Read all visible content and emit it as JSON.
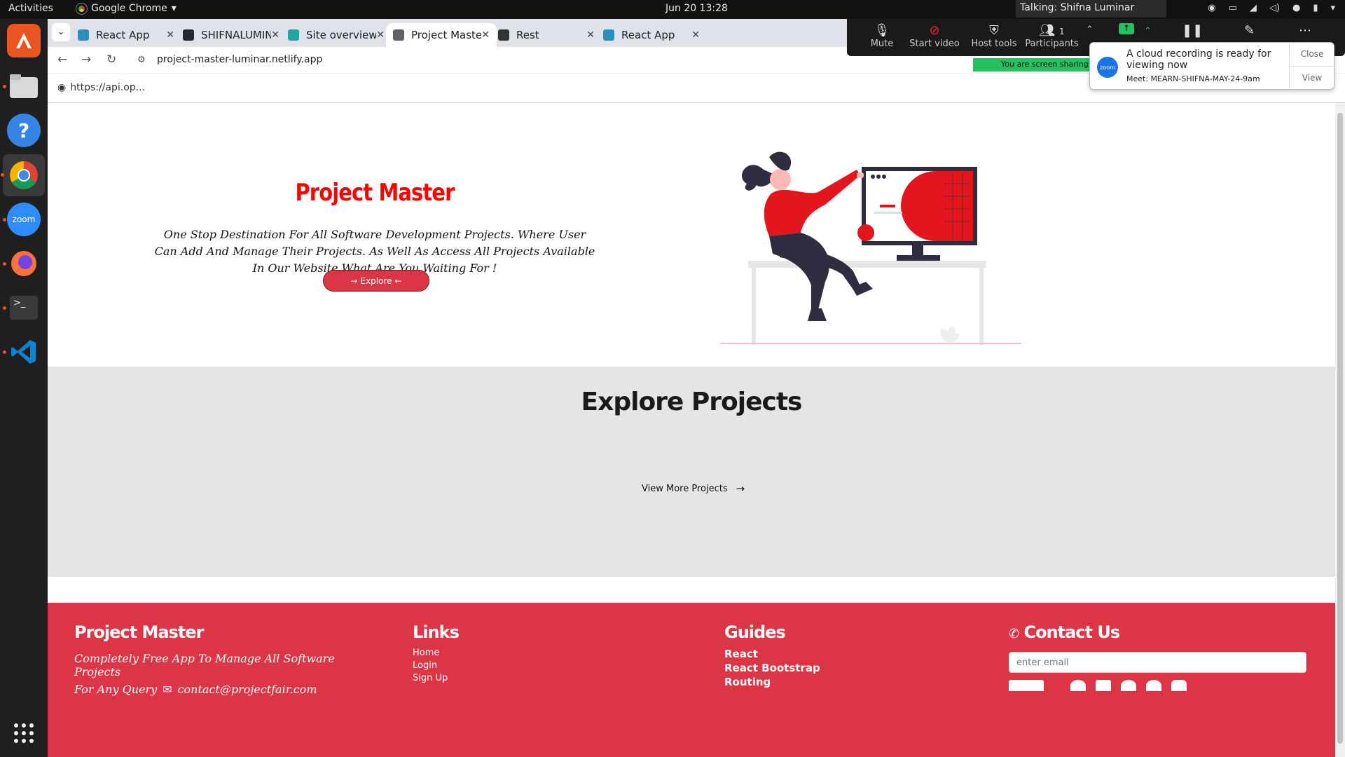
{
  "topbar": {
    "activities": "Activities",
    "app_name": "Google Chrome",
    "clock": "Jun 20  13:28",
    "talking": "Talking: Shifna Luminar"
  },
  "tabs": [
    {
      "title": "React App",
      "favicon": "react-favicon",
      "color": "#2c8ebb"
    },
    {
      "title": "SHIFNALUMINA",
      "favicon": "github-favicon",
      "color": "#24292e"
    },
    {
      "title": "Site overview | p",
      "favicon": "netlify-favicon",
      "color": "#20a7a3"
    },
    {
      "title": "Project Master",
      "favicon": "globe-favicon",
      "color": "#5f6368"
    },
    {
      "title": "Rest",
      "favicon": "angular-favicon",
      "color": "#333333"
    },
    {
      "title": "React App",
      "favicon": "react-favicon",
      "color": "#2c8ebb"
    }
  ],
  "toolbar": {
    "url": "project-master-luminar.netlify.app"
  },
  "bookmarks": {
    "item": "https://api.op..."
  },
  "zoom": {
    "mute": "Mute",
    "start_video": "Start video",
    "host_tools": "Host tools",
    "participants": "Participants",
    "participant_count": "1",
    "sharing": "You are screen sharing"
  },
  "notification": {
    "message": "A cloud recording is ready for viewing now",
    "meeting": "Meet: MEARN-SHIFNA-MAY-24-9am",
    "close": "Close",
    "view": "View",
    "logo": "zoom"
  },
  "hero": {
    "title": "Project Master",
    "description": "One Stop Destination For All Software Development Projects. Where User Can Add And Manage Their Projects. As Well As Access All Projects Available In Our Website.What Are You Waiting For !",
    "explore_label": "Explore"
  },
  "explore": {
    "title": "Explore Projects",
    "view_more": "View More Projects"
  },
  "footer": {
    "brand": "Project Master",
    "tagline": "Completely Free App To Manage All Software Projects",
    "query": "For Any Query",
    "email": "contact@projectfair.com",
    "links_title": "Links",
    "links": [
      "Home",
      "Login",
      "Sign Up"
    ],
    "guides_title": "Guides",
    "guides": [
      "React",
      "React Bootstrap",
      "Routing"
    ],
    "contact_title": "Contact Us",
    "email_placeholder": "enter email"
  },
  "colors": {
    "accent": "#dc3545",
    "title_red": "#ff0000"
  }
}
